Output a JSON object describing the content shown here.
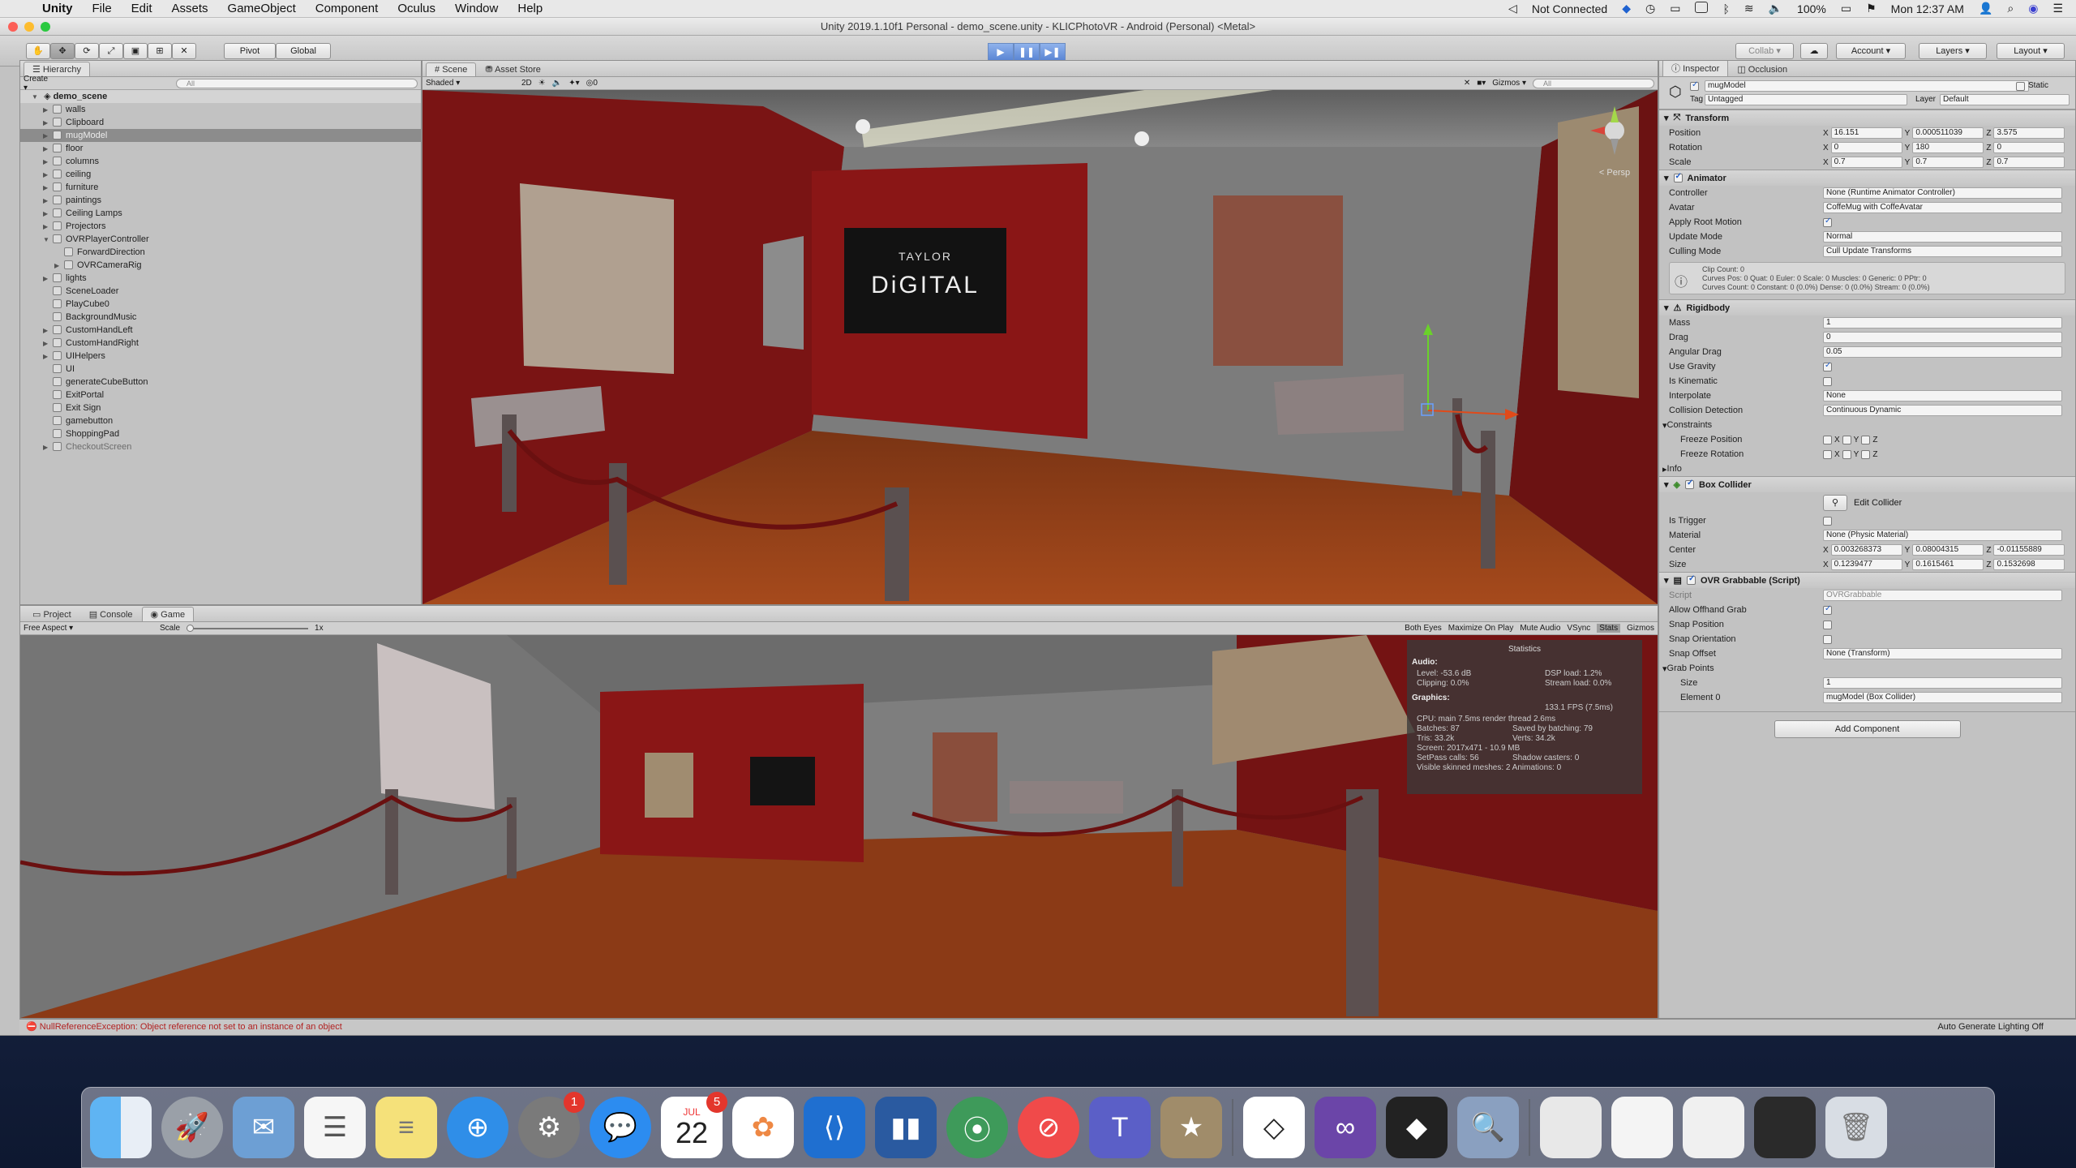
{
  "menubar": {
    "app": "Unity",
    "items": [
      "File",
      "Edit",
      "Assets",
      "GameObject",
      "Component",
      "Oculus",
      "Window",
      "Help"
    ],
    "status": "Not Connected",
    "battery": "100%",
    "clock": "Mon 12:37 AM"
  },
  "window": {
    "title": "Unity 2019.1.10f1 Personal - demo_scene.unity - KLICPhotoVR - Android (Personal) <Metal>"
  },
  "toolbar": {
    "pivot": "Pivot",
    "global": "Global",
    "collab": "Collab ▾",
    "account": "Account",
    "layers": "Layers",
    "layout": "Layout"
  },
  "hierarchy": {
    "tab": "Hierarchy",
    "create": "Create ▾",
    "search": "All",
    "root": "demo_scene",
    "items": [
      {
        "label": "walls",
        "depth": 1,
        "arrow": true
      },
      {
        "label": "Clipboard",
        "depth": 1,
        "arrow": true
      },
      {
        "label": "mugModel",
        "depth": 1,
        "arrow": true,
        "selected": true
      },
      {
        "label": "floor",
        "depth": 1,
        "arrow": true
      },
      {
        "label": "columns",
        "depth": 1,
        "arrow": true
      },
      {
        "label": "ceiling",
        "depth": 1,
        "arrow": true
      },
      {
        "label": "furniture",
        "depth": 1,
        "arrow": true
      },
      {
        "label": "paintings",
        "depth": 1,
        "arrow": true
      },
      {
        "label": "Ceiling Lamps",
        "depth": 1,
        "arrow": true
      },
      {
        "label": "Projectors",
        "depth": 1,
        "arrow": true
      },
      {
        "label": "OVRPlayerController",
        "depth": 1,
        "arrow": true,
        "open": true
      },
      {
        "label": "ForwardDirection",
        "depth": 2,
        "arrow": false
      },
      {
        "label": "OVRCameraRig",
        "depth": 2,
        "arrow": true
      },
      {
        "label": "lights",
        "depth": 1,
        "arrow": true
      },
      {
        "label": "SceneLoader",
        "depth": 1,
        "arrow": false
      },
      {
        "label": "PlayCube0",
        "depth": 1,
        "arrow": false
      },
      {
        "label": "BackgroundMusic",
        "depth": 1,
        "arrow": false
      },
      {
        "label": "CustomHandLeft",
        "depth": 1,
        "arrow": true
      },
      {
        "label": "CustomHandRight",
        "depth": 1,
        "arrow": true
      },
      {
        "label": "UIHelpers",
        "depth": 1,
        "arrow": true
      },
      {
        "label": "UI",
        "depth": 1,
        "arrow": false
      },
      {
        "label": "generateCubeButton",
        "depth": 1,
        "arrow": false
      },
      {
        "label": "ExitPortal",
        "depth": 1,
        "arrow": false
      },
      {
        "label": "Exit Sign",
        "depth": 1,
        "arrow": false
      },
      {
        "label": "gamebutton",
        "depth": 1,
        "arrow": false
      },
      {
        "label": "ShoppingPad",
        "depth": 1,
        "arrow": false
      },
      {
        "label": "CheckoutScreen",
        "depth": 1,
        "arrow": true,
        "dim": true
      }
    ]
  },
  "scene": {
    "tabs": [
      "Scene",
      "Asset Store"
    ],
    "shading": "Shaded",
    "mode2d": "2D",
    "gizmos": "Gizmos",
    "search": "All",
    "counter": "0",
    "persp": "< Persp",
    "sign_top": "TAYLOR",
    "sign_bottom": "DiGITAL"
  },
  "bottom": {
    "tabs": [
      "Project",
      "Console",
      "Game"
    ],
    "aspect": "Free Aspect",
    "scale_label": "Scale",
    "scale_value": "1x",
    "buttons": [
      "Both Eyes",
      "Maximize On Play",
      "Mute Audio",
      "VSync",
      "Stats",
      "Gizmos"
    ]
  },
  "stats": {
    "title": "Statistics",
    "audio_h": "Audio:",
    "level": "Level: -53.6 dB",
    "clipping": "Clipping: 0.0%",
    "dsp": "DSP load: 1.2%",
    "stream": "Stream load: 0.0%",
    "graphics_h": "Graphics:",
    "fps": "133.1 FPS (7.5ms)",
    "cpu": "CPU: main 7.5ms  render thread 2.6ms",
    "batches": "Batches: 87",
    "saved": "Saved by batching: 79",
    "tris": "Tris: 33.2k",
    "verts": "Verts: 34.2k",
    "screen": "Screen: 2017x471 - 10.9 MB",
    "setpass": "SetPass calls: 56",
    "shadow": "Shadow casters: 0",
    "skinned": "Visible skinned meshes: 2  Animations: 0"
  },
  "inspector": {
    "tabs": [
      "Inspector",
      "Occlusion"
    ],
    "name": "mugModel",
    "static": "Static",
    "tag_label": "Tag",
    "tag": "Untagged",
    "layer_label": "Layer",
    "layer": "Default",
    "transform": {
      "title": "Transform",
      "position_label": "Position",
      "px": "16.151",
      "py": "0.000511039",
      "pz": "3.575",
      "rotation_label": "Rotation",
      "rx": "0",
      "ry": "180",
      "rz": "0",
      "scale_label": "Scale",
      "sx": "0.7",
      "sy": "0.7",
      "sz": "0.7"
    },
    "animator": {
      "title": "Animator",
      "controller_label": "Controller",
      "controller": "None (Runtime Animator Controller)",
      "avatar_label": "Avatar",
      "avatar": "CoffeMug with CoffeAvatar",
      "root_motion_label": "Apply Root Motion",
      "update_label": "Update Mode",
      "update": "Normal",
      "culling_label": "Culling Mode",
      "culling": "Cull Update Transforms",
      "info1": "Clip Count: 0",
      "info2": "Curves Pos: 0 Quat: 0 Euler: 0 Scale: 0 Muscles: 0 Generic: 0 PPtr: 0",
      "info3": "Curves Count: 0 Constant: 0 (0.0%) Dense: 0 (0.0%) Stream: 0 (0.0%)"
    },
    "rigidbody": {
      "title": "Rigidbody",
      "mass_label": "Mass",
      "mass": "1",
      "drag_label": "Drag",
      "drag": "0",
      "angular_label": "Angular Drag",
      "angular": "0.05",
      "gravity_label": "Use Gravity",
      "kinematic_label": "Is Kinematic",
      "interp_label": "Interpolate",
      "interp": "None",
      "collision_label": "Collision Detection",
      "collision": "Continuous Dynamic",
      "constraints_label": "Constraints",
      "freeze_pos_label": "Freeze Position",
      "freeze_rot_label": "Freeze Rotation",
      "info_label": "Info"
    },
    "box": {
      "title": "Box Collider",
      "edit": "Edit Collider",
      "trigger_label": "Is Trigger",
      "material_label": "Material",
      "material": "None (Physic Material)",
      "center_label": "Center",
      "cx": "0.003268373",
      "cy": "0.08004315",
      "cz": "-0.01155889",
      "size_label": "Size",
      "sx": "0.1239477",
      "sy": "0.1615461",
      "sz": "0.1532698"
    },
    "ovr": {
      "title": "OVR Grabbable (Script)",
      "script_label": "Script",
      "script": "OVRGrabbable",
      "offhand_label": "Allow Offhand Grab",
      "snap_pos_label": "Snap Position",
      "snap_orient_label": "Snap Orientation",
      "snap_offset_label": "Snap Offset",
      "snap_offset": "None (Transform)",
      "grab_points_label": "Grab Points",
      "size_label": "Size",
      "size": "1",
      "element_label": "Element 0",
      "element": "mugModel (Box Collider)"
    },
    "add_component": "Add Component"
  },
  "status": {
    "error": "NullReferenceException: Object reference not set to an instance of an object",
    "right": "Auto Generate Lighting Off"
  },
  "dock": {
    "calendar_month": "JUL",
    "calendar_day": "22",
    "calendar_badge": "5",
    "settings_badge": "1"
  },
  "colors": {
    "wall_red": "#7a1414",
    "floor": "#8a3a14",
    "panel": "#c2c2c2",
    "accent": "#3b6fd6"
  }
}
